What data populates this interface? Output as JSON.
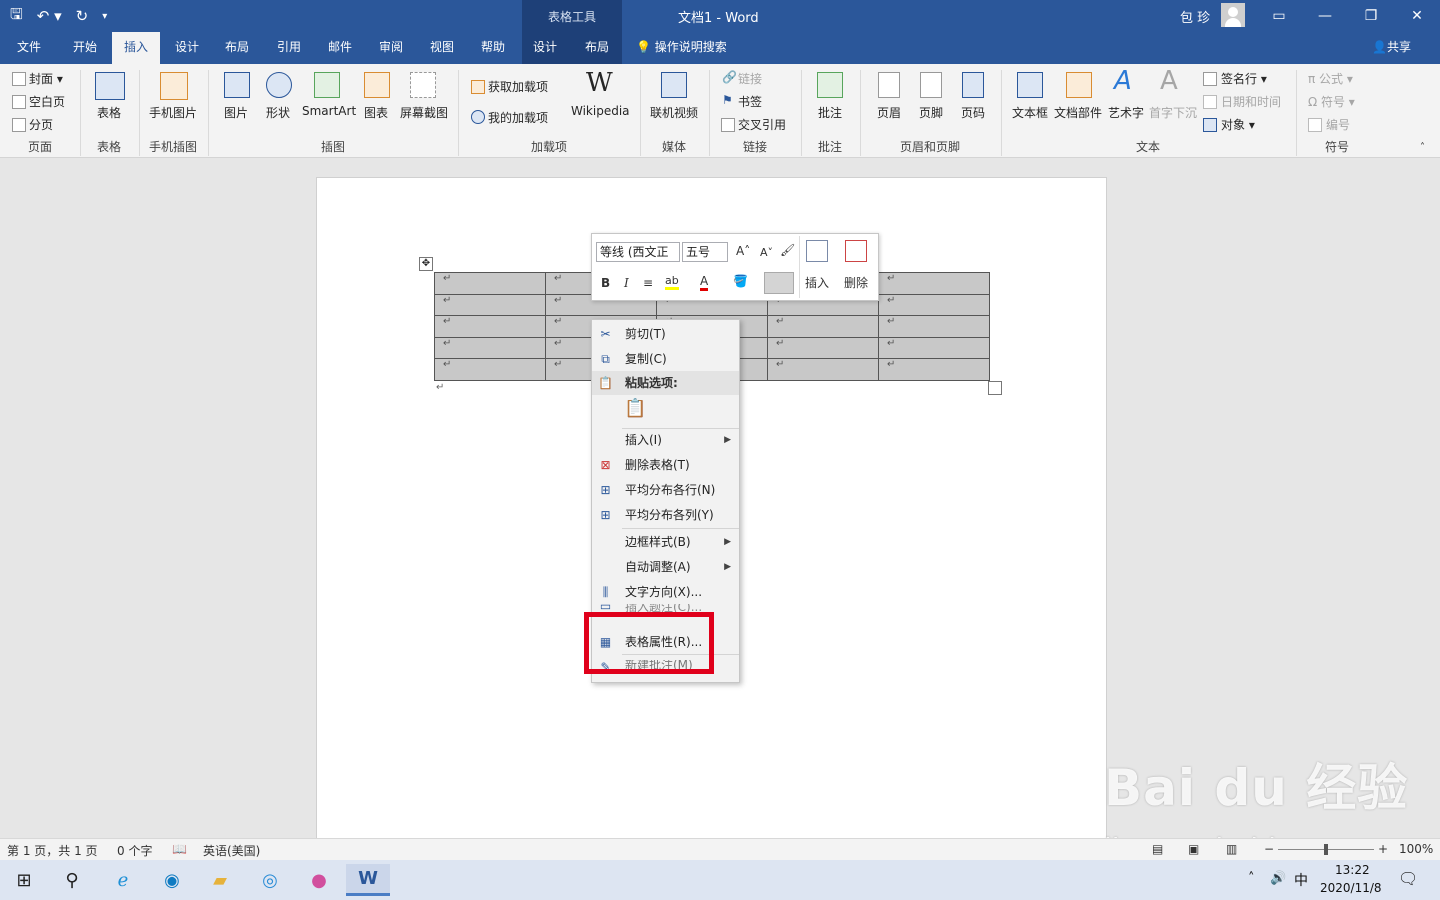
{
  "title_bar": {
    "qat_save": "🖫",
    "qat_undo": "↶ ▾",
    "qat_redo": "↻",
    "qat_customize": "▾",
    "tool_tab_header": "表格工具",
    "doc_title": "文档1  -  Word",
    "user_name": "包 珍",
    "icons": {
      "ribbon_display": "▭",
      "minimize": "—",
      "restore": "❐",
      "close": "✕"
    }
  },
  "tabs": [
    "文件",
    "开始",
    "插入",
    "设计",
    "布局",
    "引用",
    "邮件",
    "审阅",
    "视图",
    "帮助",
    "设计",
    "布局"
  ],
  "active_tab": "插入",
  "search": "操作说明搜索",
  "share": "共享",
  "ribbon": {
    "pages": {
      "cover": "封面 ▾",
      "blank": "空白页",
      "break": "分页",
      "group": "页面"
    },
    "table": {
      "label": "表格",
      "group": "表格"
    },
    "phone_illus": {
      "label": "手机图片",
      "group": "手机插图"
    },
    "illustrations": {
      "picture": "图片",
      "shapes": "形状",
      "smartart": "SmartArt",
      "chart": "图表",
      "screenshot": "屏幕截图",
      "group": "插图"
    },
    "addins": {
      "get": "获取加载项",
      "my": "我的加载项",
      "wiki": "Wikipedia",
      "wiki_glyph": "W",
      "group": "加载项"
    },
    "media": {
      "video": "联机视频",
      "group": "媒体"
    },
    "links": {
      "link": "链接",
      "bookmark": "书签",
      "crossref": "交叉引用",
      "group": "链接"
    },
    "comments": {
      "comment": "批注",
      "group": "批注"
    },
    "header_footer": {
      "header": "页眉",
      "footer": "页脚",
      "page_number": "页码",
      "group": "页眉和页脚"
    },
    "text": {
      "textbox": "文本框",
      "quickparts": "文档部件",
      "wordart": "艺术字",
      "dropcap": "首字下沉",
      "signature": "签名行 ▾",
      "datetime": "日期和时间",
      "object": "对象 ▾",
      "group": "文本"
    },
    "symbols": {
      "equation": "π 公式 ▾",
      "symbol": "Ω 符号 ▾",
      "number": "编号",
      "group": "符号"
    }
  },
  "mini_toolbar": {
    "font": "等线 (西文正",
    "size": "五号",
    "grow": "A˄",
    "shrink": "A˅",
    "bold": "B",
    "italic": "I",
    "align": "≡",
    "highlight": "ab",
    "font_color": "A",
    "insert": "插入",
    "delete": "删除",
    "colors": {
      "highlight": "#ffff00",
      "font": "#e00000"
    }
  },
  "table": {
    "rows": 5,
    "cols": 5,
    "cell_mark": "↵"
  },
  "context_menu": {
    "cut": "剪切(T)",
    "copy": "复制(C)",
    "paste_header": "粘贴选项:",
    "insert": "插入(I)",
    "delete_table": "删除表格(T)",
    "dist_rows": "平均分布各行(N)",
    "dist_cols": "平均分布各列(Y)",
    "border_styles": "边框样式(B)",
    "autofit": "自动调整(A)",
    "text_direction": "文字方向(X)...",
    "table_props": "表格属性(R)...",
    "hidden_row_1": "插入题注(C)...",
    "hidden_row_2": "新建批注(M)"
  },
  "status_bar": {
    "page": "第 1 页，共 1 页",
    "words": "0 个字",
    "language": "英语(美国)",
    "zoom": "100%",
    "zoom_minus": "−",
    "zoom_plus": "+"
  },
  "taskbar": {
    "ime": "中",
    "time": "13:22",
    "date": "2020/11/8"
  },
  "watermark": {
    "main": "Bai du 经验",
    "sub": "jingyan.baidu.com"
  }
}
